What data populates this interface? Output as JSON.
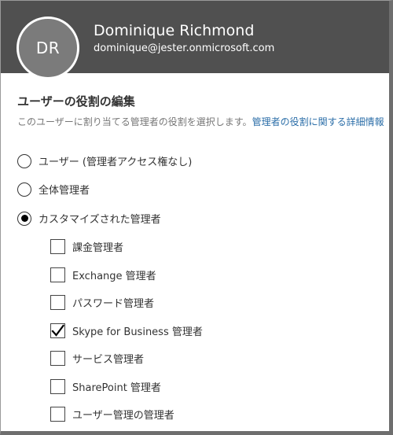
{
  "user": {
    "initials": "DR",
    "name": "Dominique Richmond",
    "email": "dominique@jester.onmicrosoft.com"
  },
  "section": {
    "title": "ユーザーの役割の編集",
    "description": "このユーザーに割り当てる管理者の役割を選択します。",
    "link_text": "管理者の役割に関する詳細情報"
  },
  "roles": [
    {
      "label": "ユーザー (管理者アクセス権なし)",
      "selected": false
    },
    {
      "label": "全体管理者",
      "selected": false
    },
    {
      "label": "カスタマイズされた管理者",
      "selected": true
    }
  ],
  "custom_roles": [
    {
      "label": "課金管理者",
      "checked": false
    },
    {
      "label": "Exchange 管理者",
      "checked": false
    },
    {
      "label": "パスワード管理者",
      "checked": false
    },
    {
      "label": "Skype for Business 管理者",
      "checked": true
    },
    {
      "label": "サービス管理者",
      "checked": false
    },
    {
      "label": "SharePoint 管理者",
      "checked": false
    },
    {
      "label": "ユーザー管理の管理者",
      "checked": false
    }
  ],
  "icons": {
    "radio_selected": "radio-selected-icon",
    "radio_unselected": "radio-unselected-icon",
    "checkbox_checked": "check-icon"
  }
}
